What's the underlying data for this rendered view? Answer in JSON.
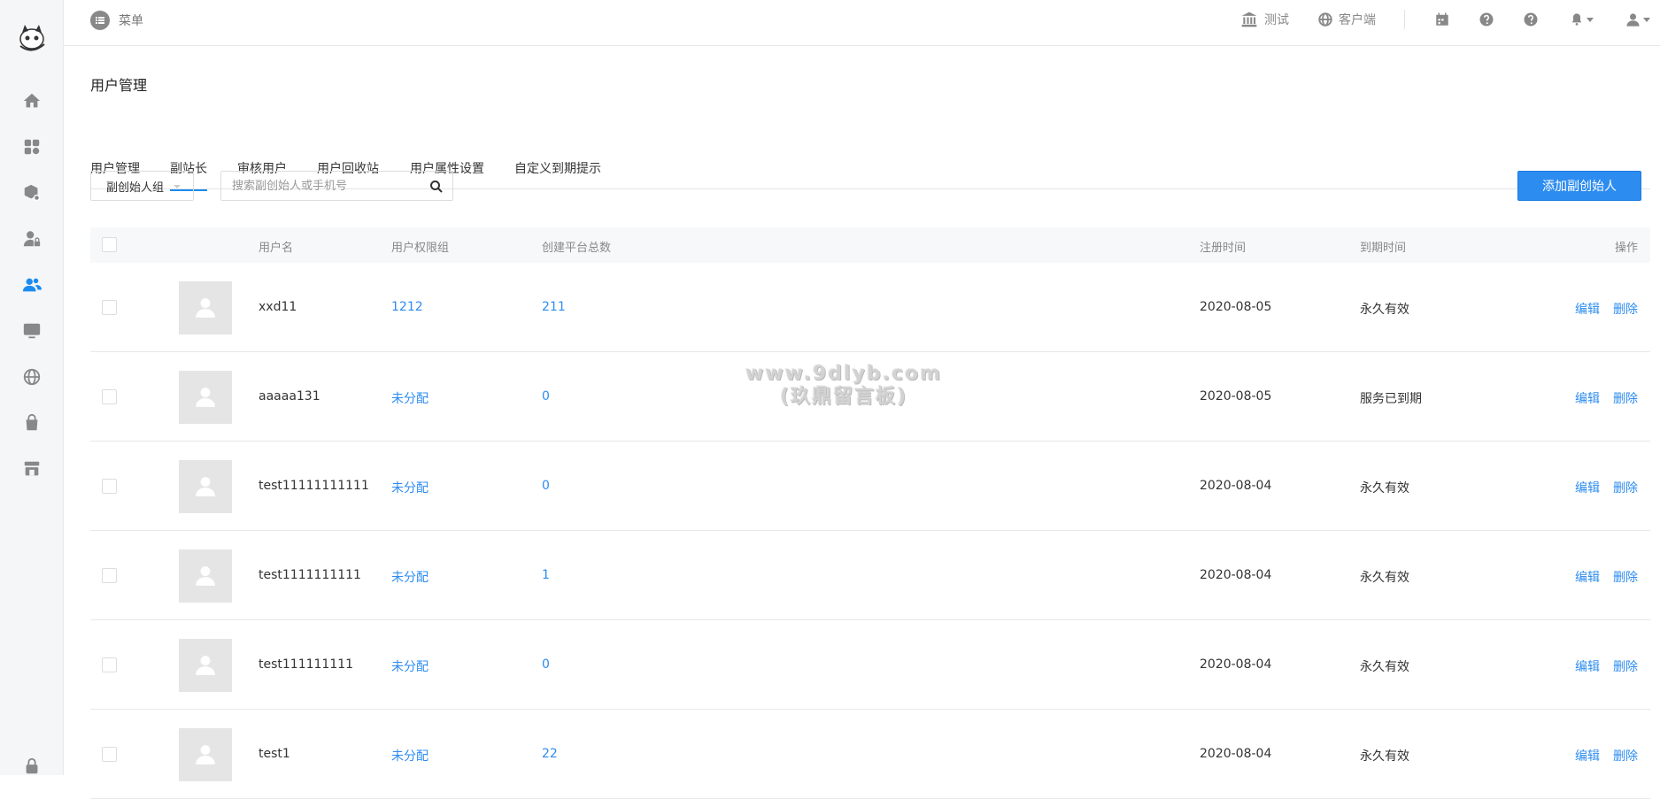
{
  "header": {
    "menu_label": "菜单",
    "links": [
      {
        "label": "测试",
        "icon": "bank-icon"
      },
      {
        "label": "客户端",
        "icon": "globe-icon"
      }
    ]
  },
  "sidebar": {
    "active_index": 4,
    "items": [
      "home-icon",
      "apps-icon",
      "package-settings-icon",
      "user-lock-icon",
      "users-icon",
      "monitor-icon",
      "globe-icon",
      "bag-icon",
      "store-icon"
    ]
  },
  "page": {
    "title": "用户管理",
    "tabs": [
      "用户管理",
      "副站长",
      "审核用户",
      "用户回收站",
      "用户属性设置",
      "自定义到期提示"
    ],
    "active_tab": 1
  },
  "filters": {
    "group_select": "副创始人组",
    "search_placeholder": "搜索副创始人或手机号",
    "add_button": "添加副创始人"
  },
  "table": {
    "headers": {
      "username": "用户名",
      "group": "用户权限组",
      "platforms": "创建平台总数",
      "registered": "注册时间",
      "expires": "到期时间",
      "actions": "操作"
    },
    "edit_label": "编辑",
    "delete_label": "删除",
    "rows": [
      {
        "username": "xxd11",
        "group": "1212",
        "platforms": "211",
        "registered": "2020-08-05",
        "expires": "永久有效"
      },
      {
        "username": "aaaaa131",
        "group": "未分配",
        "platforms": "0",
        "registered": "2020-08-05",
        "expires": "服务已到期"
      },
      {
        "username": "test11111111111",
        "group": "未分配",
        "platforms": "0",
        "registered": "2020-08-04",
        "expires": "永久有效"
      },
      {
        "username": "test1111111111",
        "group": "未分配",
        "platforms": "1",
        "registered": "2020-08-04",
        "expires": "永久有效"
      },
      {
        "username": "test111111111",
        "group": "未分配",
        "platforms": "0",
        "registered": "2020-08-04",
        "expires": "永久有效"
      },
      {
        "username": "test1",
        "group": "未分配",
        "platforms": "22",
        "registered": "2020-08-04",
        "expires": "永久有效"
      }
    ]
  },
  "watermark": {
    "line1": "www.9dlyb.com",
    "line2": "(玖鼎留言板)"
  },
  "colors": {
    "accent": "#2d8cf0",
    "sidebar_bg": "#f5f6f8"
  }
}
